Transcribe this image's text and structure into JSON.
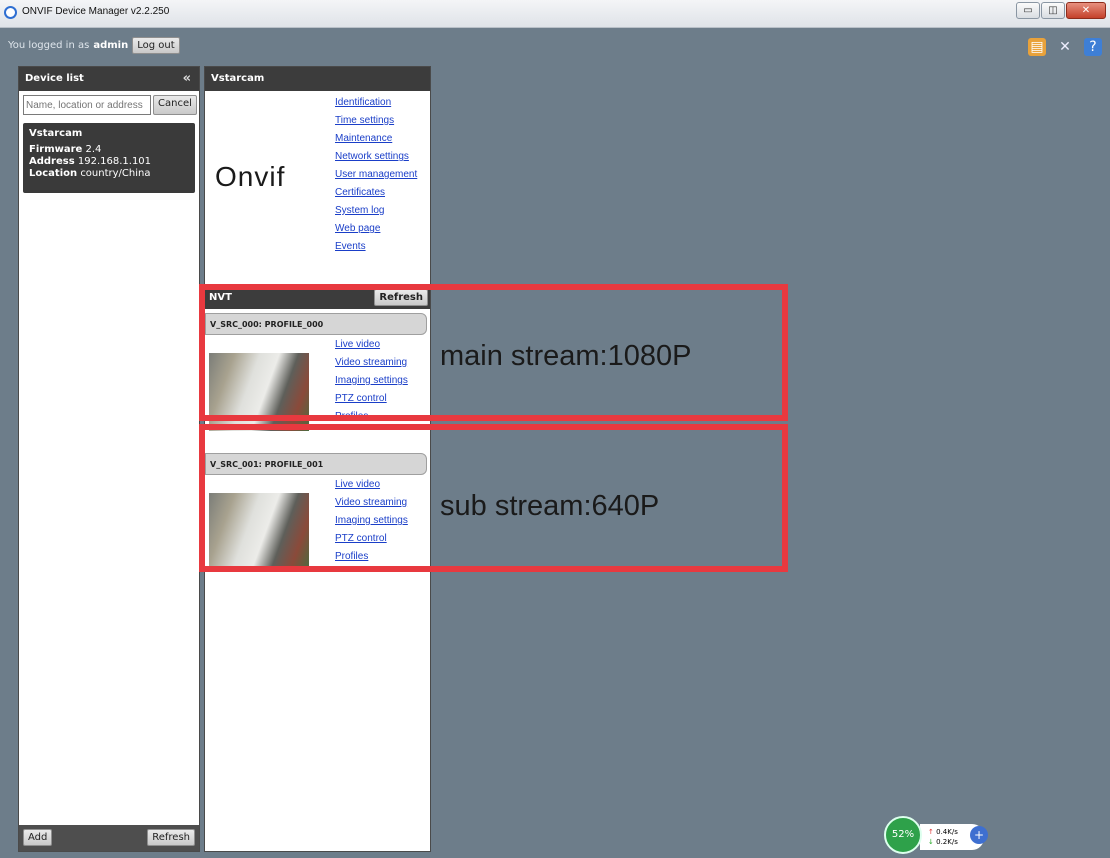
{
  "window": {
    "title": "ONVIF Device Manager v2.2.250"
  },
  "login": {
    "prefix": "You logged in as",
    "user": "admin",
    "logout": "Log out"
  },
  "device_list": {
    "title": "Device list",
    "collapse": "«",
    "search_placeholder": "Name, location or address",
    "cancel": "Cancel",
    "device": {
      "name": "Vstarcam",
      "firmware_label": "Firmware",
      "firmware": "2.4",
      "address_label": "Address",
      "address": "192.168.1.101",
      "location_label": "Location",
      "location": "country/China"
    },
    "add": "Add",
    "refresh": "Refresh"
  },
  "device_panel": {
    "title": "Vstarcam",
    "logo": "Onvif",
    "links": [
      "Identification",
      "Time settings",
      "Maintenance",
      "Network settings",
      "User management",
      "Certificates",
      "System log",
      "Web page",
      "Events"
    ],
    "nvt_label": "NVT",
    "nvt_refresh": "Refresh"
  },
  "profiles": [
    {
      "header": "V_SRC_000: PROFILE_000",
      "links": [
        "Live video",
        "Video streaming",
        "Imaging settings",
        "PTZ control",
        "Profiles"
      ],
      "annotation": "main stream:1080P"
    },
    {
      "header": "V_SRC_001: PROFILE_001",
      "links": [
        "Live video",
        "Video streaming",
        "Imaging settings",
        "PTZ control",
        "Profiles"
      ],
      "annotation": "sub stream:640P"
    }
  ],
  "net_monitor": {
    "percent": "52%",
    "up": "0.4K/s",
    "down": "0.2K/s"
  },
  "colors": {
    "background": "#6d7d8a",
    "panel_header": "#3c3c3c",
    "link": "#1a3ec8",
    "annotation_box": "#e8393f"
  }
}
